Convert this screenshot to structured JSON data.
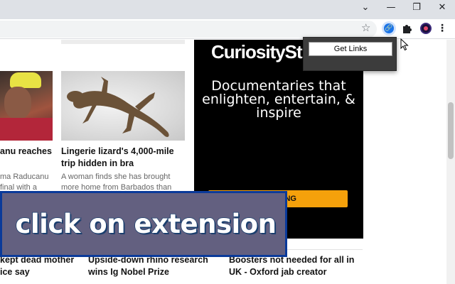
{
  "browser": {
    "window_controls": {
      "chevron": "⌄",
      "minimize": "—",
      "maximize": "❐",
      "close": "✕"
    },
    "toolbar": {
      "bookmark_icon": "☆",
      "menu_icon": "⋮",
      "extension_icon": "🔗"
    }
  },
  "page": {
    "articles_top": [
      {
        "headline": "anu reaches",
        "summary": "ma Raducanu\nfinal with a"
      },
      {
        "headline": "Lingerie lizard's 4,000-mile trip hidden in bra",
        "summary": "A woman finds she has brought more home from Barbados than"
      }
    ],
    "articles_bottom": [
      {
        "headline": "kept dead mother\nice say"
      },
      {
        "headline": "Upside-down rhino research wins Ig Nobel Prize"
      },
      {
        "headline": "Boosters not needed for all in UK - Oxford jab creator"
      }
    ],
    "ad": {
      "logo": "CuriositySt",
      "tagline": "Documentaries that enlighten, entertain, & inspire",
      "cta": "REAMING"
    }
  },
  "extension_popup": {
    "button_label": "Get Links"
  },
  "overlay": {
    "caption": "click on extension"
  },
  "colors": {
    "ad_cta": "#f5a10b",
    "overlay_bg": "#636080",
    "overlay_border": "#0a3a9a"
  }
}
